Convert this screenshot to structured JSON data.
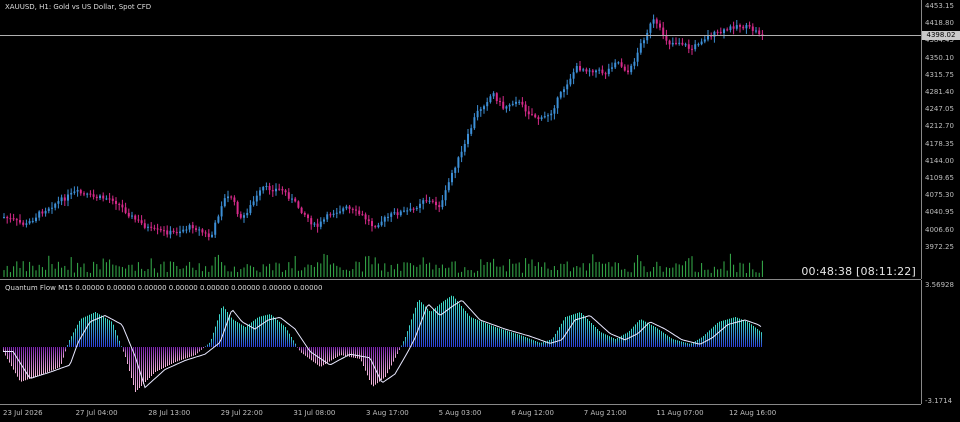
{
  "header": {
    "symbol_title": "XAUUSD, H1:  Gold vs US Dollar, Spot CFD",
    "indicator_title": "Quantum Flow M15 0.00000 0.00000 0.00000 0.00000 0.00000 0.00000 0.00000 0.00000"
  },
  "timer": "00:48:38 [08:11:22]",
  "price_axis": {
    "labels": [
      "4453.15",
      "4418.80",
      "4384.45",
      "4350.10",
      "4315.75",
      "4281.40",
      "4247.05",
      "4212.70",
      "4178.35",
      "4144.00",
      "4109.65",
      "4075.30",
      "4040.95",
      "4006.60",
      "3972.25"
    ],
    "current_price": "4398.02"
  },
  "indicator_axis": {
    "top": "3.56928",
    "bottom": "-3.1714"
  },
  "time_axis": {
    "labels": [
      "23 Jul 2026",
      "27 Jul 04:00",
      "28 Jul 13:00",
      "29 Jul 22:00",
      "31 Jul 08:00",
      "3 Aug 17:00",
      "5 Aug 03:00",
      "6 Aug 12:00",
      "7 Aug 21:00",
      "11 Aug 07:00",
      "12 Aug 16:00"
    ]
  },
  "colors": {
    "bull": "#3d8fd6",
    "bear": "#d62a8a",
    "volume": "#37b24d",
    "grid_line": "#888888",
    "osc_pos_top": "#3fe0c8",
    "osc_pos_bottom": "#2b3bd6",
    "osc_neg_top": "#7a1fb0",
    "osc_neg_bottom": "#f2b8d8",
    "signal_line": "#e8e8ff"
  }
}
